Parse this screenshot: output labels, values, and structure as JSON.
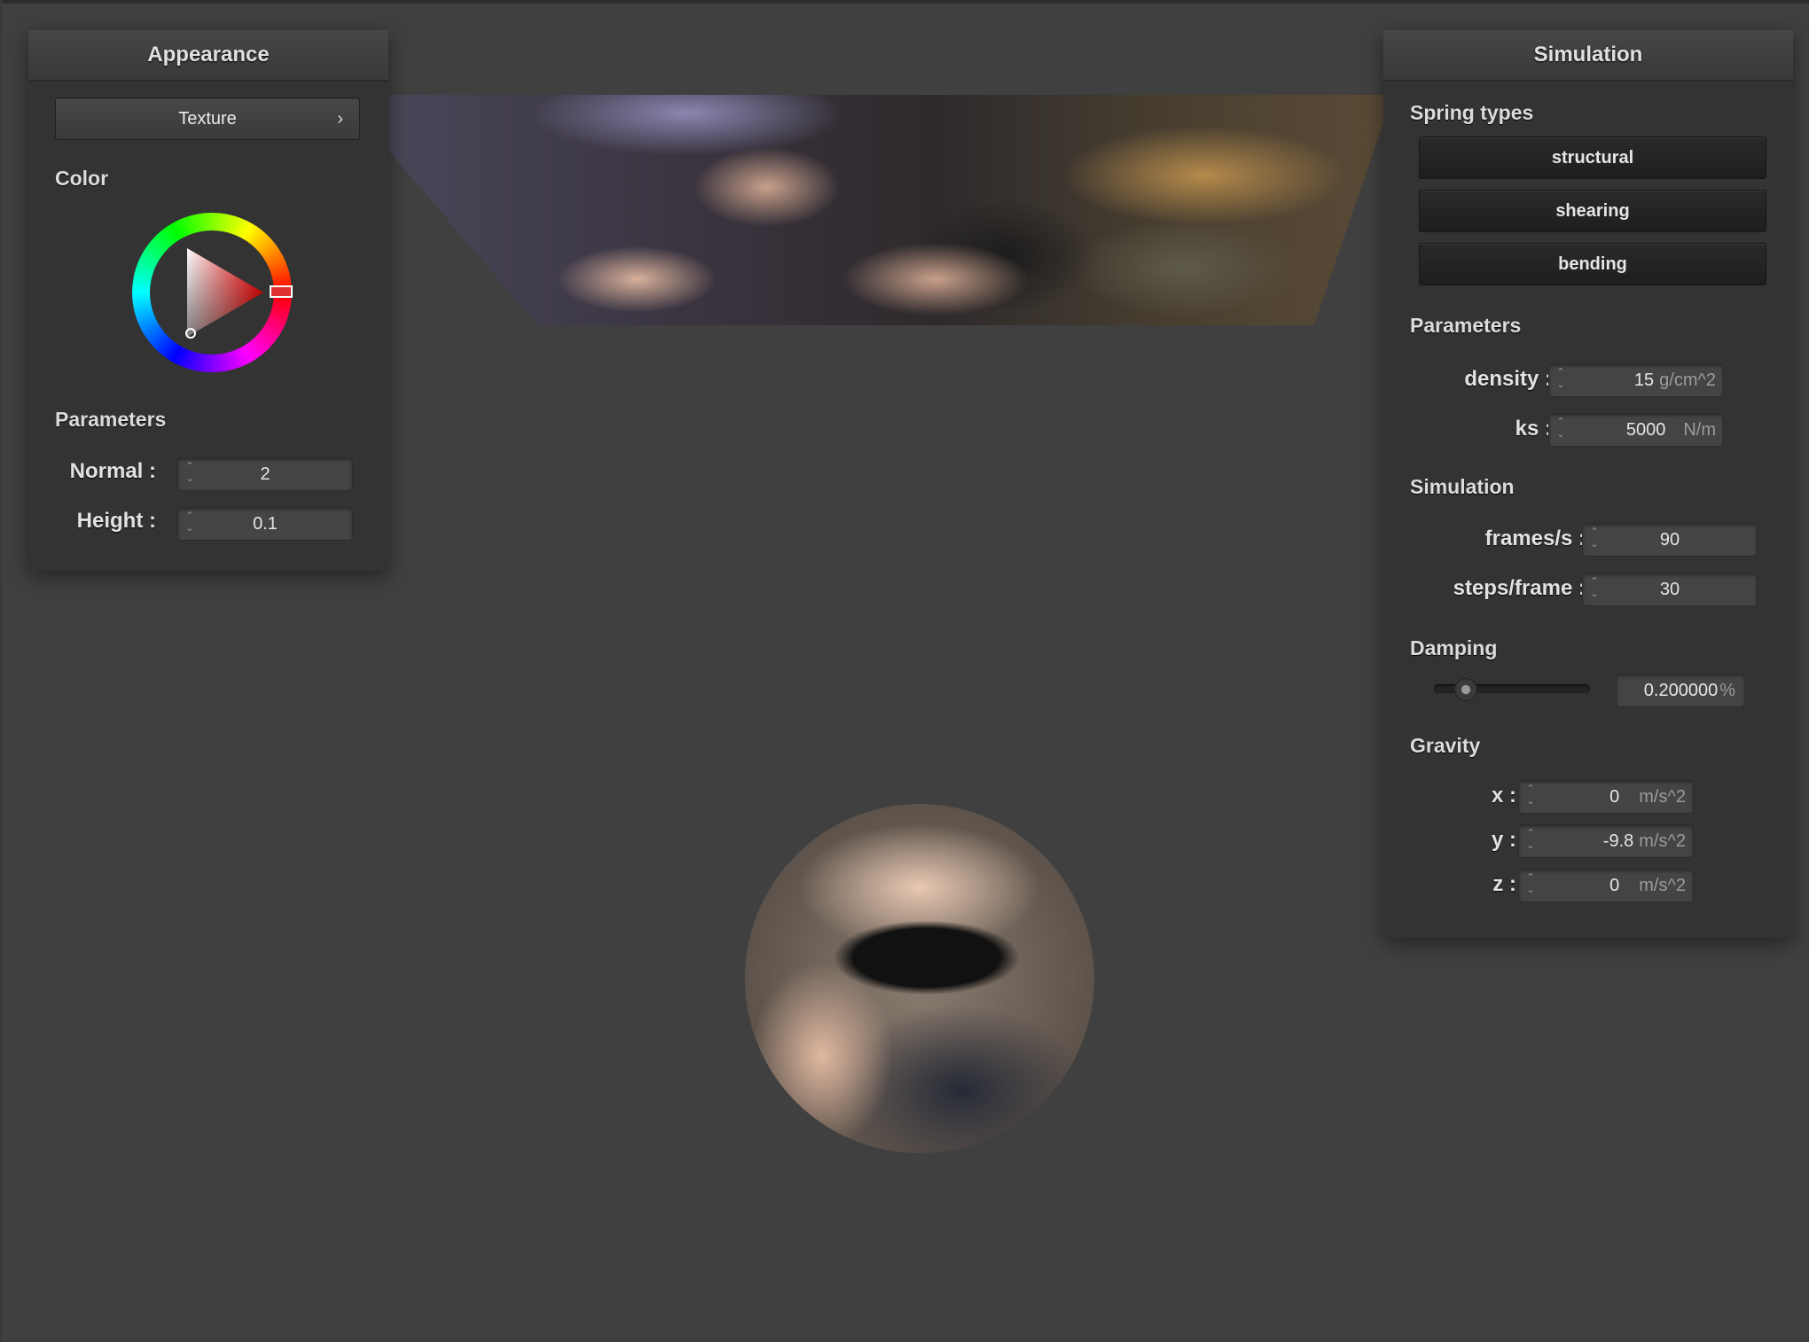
{
  "appearance": {
    "title": "Appearance",
    "texture_button": "Texture",
    "color_section": "Color",
    "params_section": "Parameters",
    "normal": {
      "label": "Normal :",
      "value": "2"
    },
    "height": {
      "label": "Height :",
      "value": "0.1"
    },
    "color_hex": "#e03030"
  },
  "simulation": {
    "title": "Simulation",
    "spring_types_section": "Spring types",
    "spring_types": [
      "structural",
      "shearing",
      "bending"
    ],
    "params_section": "Parameters",
    "density": {
      "label": "density :",
      "value": "15",
      "unit": "g/cm^2"
    },
    "ks": {
      "label": "ks :",
      "value": "5000",
      "unit": "N/m"
    },
    "sim_section": "Simulation",
    "frames": {
      "label": "frames/s :",
      "value": "90"
    },
    "steps": {
      "label": "steps/frame :",
      "value": "30"
    },
    "damping_section": "Damping",
    "damping": {
      "value": "0.200000",
      "unit": "%",
      "slider_fraction": 0.2
    },
    "gravity_section": "Gravity",
    "gx": {
      "label": "x :",
      "value": "0",
      "unit": "m/s^2"
    },
    "gy": {
      "label": "y :",
      "value": "-9.8",
      "unit": "m/s^2"
    },
    "gz": {
      "label": "z :",
      "value": "0",
      "unit": "m/s^2"
    }
  }
}
